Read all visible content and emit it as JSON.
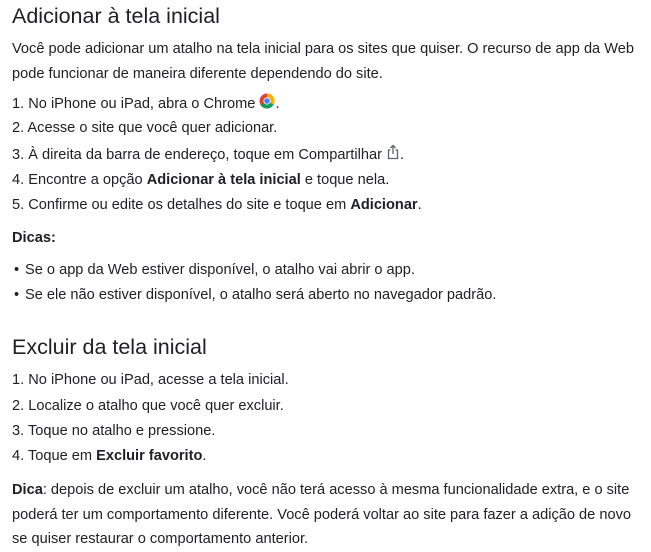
{
  "section1": {
    "title": "Adicionar à tela inicial",
    "intro_line1": "Você pode adicionar um atalho na tela inicial para os sites que quiser. O recurso de app da Web",
    "intro_line2": "pode funcionar de maneira diferente dependendo do site.",
    "steps": [
      {
        "num": "1.",
        "text": "No iPhone ou iPad, abra o Chrome",
        "icon": "chrome-icon",
        "after": "."
      },
      {
        "num": "2.",
        "text": "Acesse o site que você quer adicionar."
      },
      {
        "num": "3.",
        "text": "À direita da barra de endereço, toque em Compartilhar",
        "icon": "share-icon",
        "after": "."
      },
      {
        "num": "4.",
        "pre": "Encontre a opção ",
        "bold": "Adicionar à tela inicial",
        "post": " e toque nela."
      },
      {
        "num": "5.",
        "pre": "Confirme ou edite os detalhes do site e toque em ",
        "bold": "Adicionar",
        "post": "."
      }
    ],
    "tips_label": "Dicas:",
    "tips": [
      "Se o app da Web estiver disponível, o atalho vai abrir o app.",
      "Se ele não estiver disponível, o atalho será aberto no navegador padrão."
    ]
  },
  "section2": {
    "title": "Excluir da tela inicial",
    "steps": [
      {
        "num": "1.",
        "text": "No iPhone ou iPad, acesse a tela inicial."
      },
      {
        "num": "2.",
        "text": "Localize o atalho que você quer excluir."
      },
      {
        "num": "3.",
        "text": "Toque no atalho e pressione."
      },
      {
        "num": "4.",
        "pre": "Toque em ",
        "bold": "Excluir favorito",
        "post": "."
      }
    ],
    "tip_label": "Dica",
    "tip_line1": ": depois de excluir um atalho, você não terá acesso à mesma funcionalidade extra, e o site",
    "tip_line2": "poderá ter um comportamento diferente. Você poderá voltar ao site para fazer a adição de novo",
    "tip_line3": "se quiser restaurar o comportamento anterior."
  },
  "colors": {
    "text": "#202124",
    "chrome_red": "#db4437",
    "chrome_yellow": "#f4b400",
    "chrome_green": "#0f9d58",
    "chrome_blue": "#4285f4"
  }
}
